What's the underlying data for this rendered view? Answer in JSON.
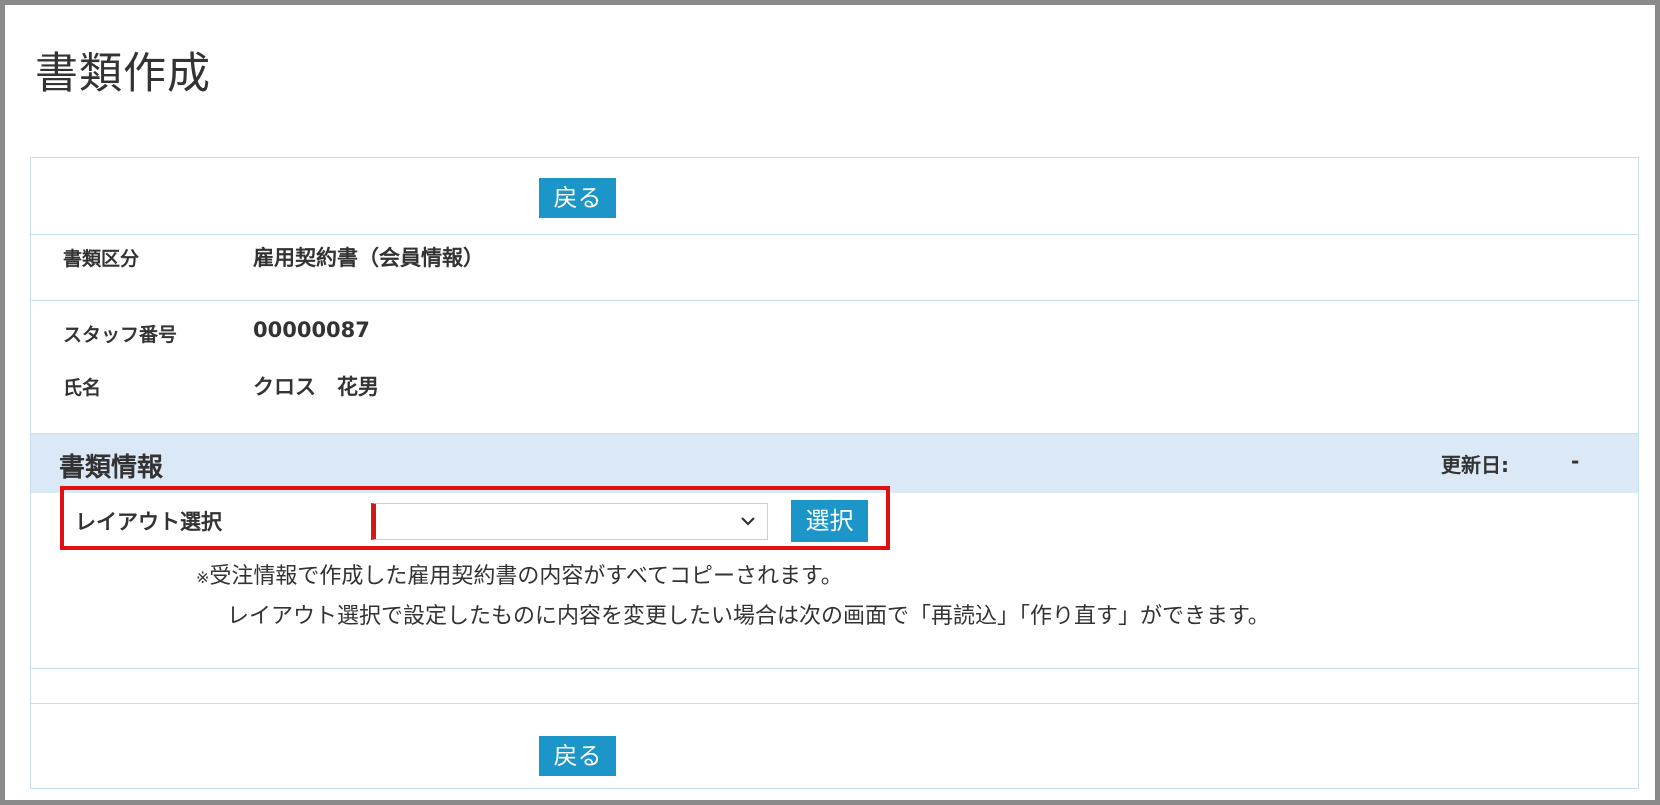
{
  "page": {
    "title": "書類作成"
  },
  "buttons": {
    "back_top": "戻る",
    "back_bottom": "戻る",
    "select": "選択"
  },
  "fields": {
    "doc_category_label": "書類区分",
    "doc_category_value": "雇用契約書（会員情報）",
    "staff_no_label": "スタッフ番号",
    "staff_no_value": "00000087",
    "name_label": "氏名",
    "name_value": "クロス　花男"
  },
  "section": {
    "title": "書類情報",
    "updated_label": "更新日:",
    "updated_value": "-"
  },
  "layout": {
    "label": "レイアウト選択",
    "selected_value": ""
  },
  "notes": {
    "mark": "※",
    "line1": "受注情報で作成した雇用契約書の内容がすべてコピーされます。",
    "line2": "レイアウト選択で設定したものに内容を変更したい場合は次の画面で「再読込」「作り直す」ができます。"
  },
  "colors": {
    "button": "#1c96c9",
    "section_header_bg": "#dbe9f7",
    "highlight": "#e01010",
    "frame_border": "#8a8a8a"
  }
}
